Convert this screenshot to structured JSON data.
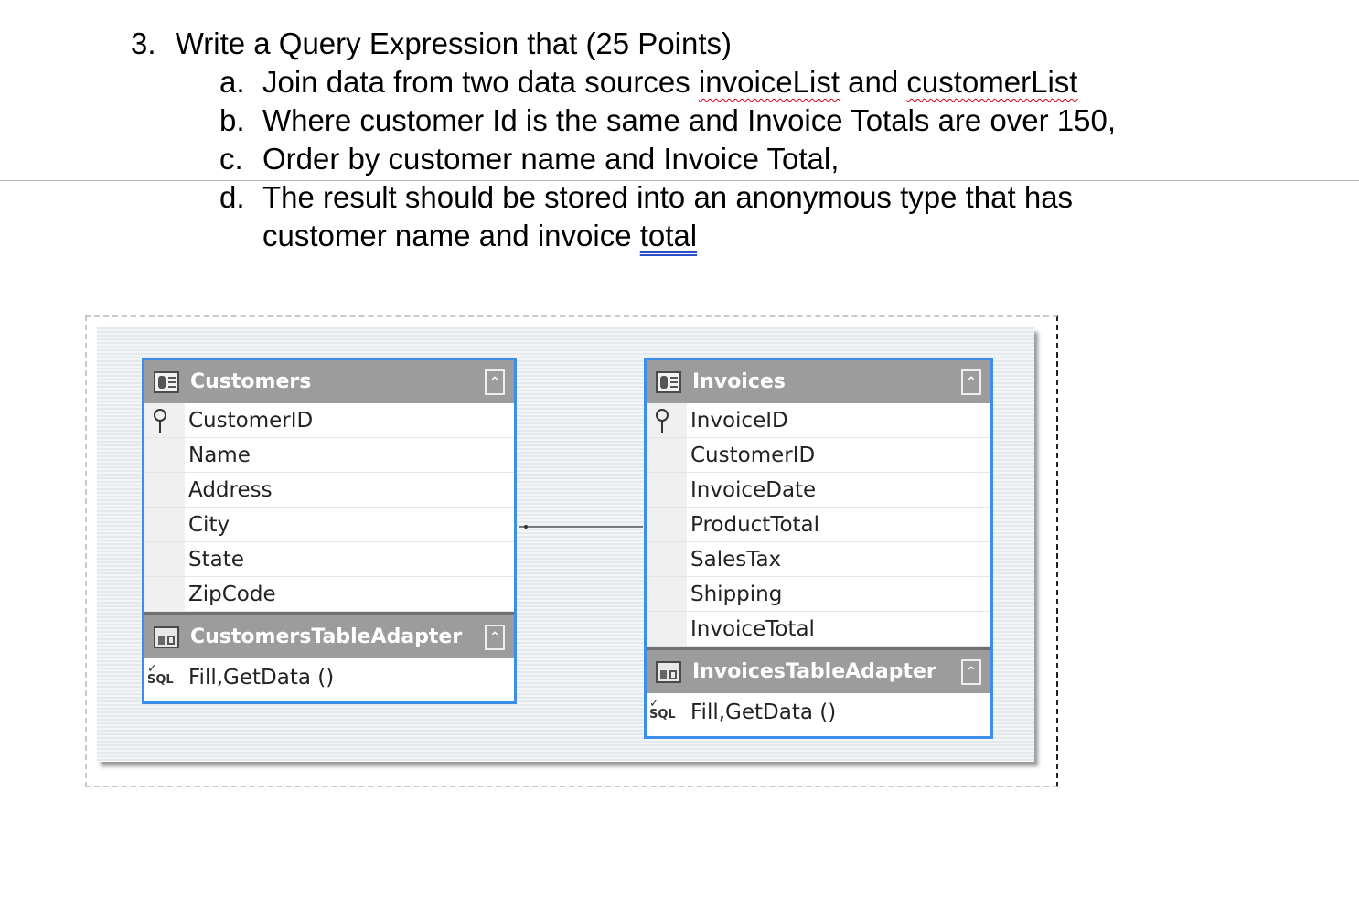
{
  "question": {
    "number": "3.",
    "title": "Write a Query Expression that (25 Points)",
    "items": [
      {
        "letter": "a.",
        "pre": "Join data from two data sources ",
        "w1": "invoiceList",
        "mid": " and ",
        "w2": "customerList"
      },
      {
        "letter": "b.",
        "text": "Where customer Id is the same and Invoice Totals are over 150,"
      },
      {
        "letter": "c.",
        "text": "Order by customer name and Invoice Total,"
      },
      {
        "letter": "d.",
        "text": "The result should be stored into an anonymous type that has",
        "cont_pre": "customer name and invoice ",
        "cont_word": "total"
      }
    ]
  },
  "diagram": {
    "customers": {
      "title": "Customers",
      "fields": [
        "CustomerID",
        "Name",
        "Address",
        "City",
        "State",
        "ZipCode"
      ],
      "adapter": "CustomersTableAdapter",
      "method": "Fill,GetData ()"
    },
    "invoices": {
      "title": "Invoices",
      "fields": [
        "InvoiceID",
        "CustomerID",
        "InvoiceDate",
        "ProductTotal",
        "SalesTax",
        "Shipping",
        "InvoiceTotal"
      ],
      "adapter": "InvoicesTableAdapter",
      "method": "Fill,GetData ()"
    }
  },
  "icons": {
    "key": "key-icon",
    "table": "table-icon",
    "adapter": "table-adapter-icon",
    "sql": "sql-icon",
    "collapse": "collapse-icon"
  },
  "colors": {
    "selection_border": "#3d8ee8",
    "header_bg": "#9c9c9c",
    "spell_squiggle": "#d0021b",
    "grammar_underline": "#2b50c8"
  }
}
